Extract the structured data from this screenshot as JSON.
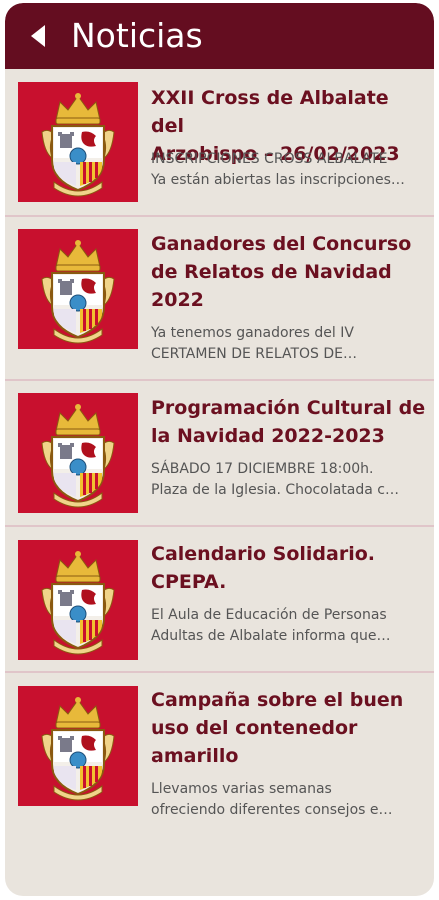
{
  "header": {
    "title": "Noticias",
    "back_icon": "back-arrow-icon"
  },
  "colors": {
    "header_bg": "#640d20",
    "title_color": "#6b1020",
    "page_bg": "#e9e4dd",
    "thumb_bg": "#c8102e"
  },
  "news": [
    {
      "title_lines": [
        "XXII Cross de Albalate del",
        "Arzobispo – 26/02/2023"
      ],
      "desc_lines": [
        "INSCRIPCIONES CROSS ALBALATE",
        "Ya están abiertas las inscripciones…"
      ],
      "image": "coat-of-arms-icon"
    },
    {
      "title_lines": [
        "Ganadores del Concurso",
        "de Relatos de Navidad",
        "2022"
      ],
      "desc_lines": [
        "Ya tenemos ganadores del IV",
        "CERTAMEN DE RELATOS DE…"
      ],
      "image": "coat-of-arms-icon"
    },
    {
      "title_lines": [
        "Programación Cultural de",
        "la Navidad 2022-2023"
      ],
      "desc_lines": [
        "SÁBADO 17 DICIEMBRE 18:00h.",
        "Plaza de la Iglesia. Chocolatada c…"
      ],
      "image": "coat-of-arms-icon"
    },
    {
      "title_lines": [
        "Calendario Solidario.",
        "CPEPA."
      ],
      "desc_lines": [
        "El Aula de Educación de Personas",
        "Adultas de Albalate informa que…"
      ],
      "image": "coat-of-arms-icon"
    },
    {
      "title_lines": [
        "Campaña sobre el buen",
        "uso del contenedor",
        "amarillo"
      ],
      "desc_lines": [
        "Llevamos varias semanas",
        "ofreciendo diferentes consejos e…"
      ],
      "image": "coat-of-arms-icon"
    }
  ]
}
